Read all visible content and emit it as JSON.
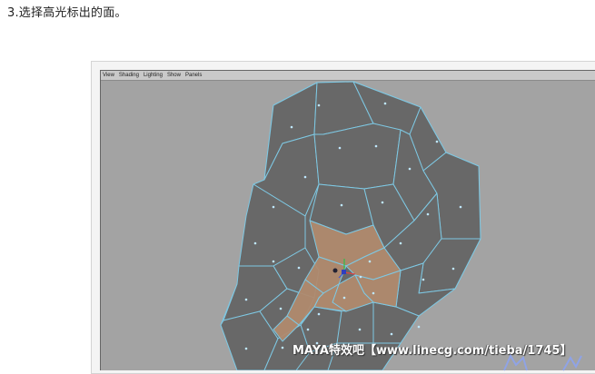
{
  "instruction": {
    "text": "3.选择高光标出的面。"
  },
  "viewport": {
    "menu": [
      "View",
      "Shading",
      "Lighting",
      "Show",
      "Panels"
    ],
    "background_color": "#a3a3a3",
    "face_color": "#686868",
    "selected_face_color": "#b08a6e",
    "edge_color": "#7ec8e3",
    "face_dot_color": "#bfe8ff"
  },
  "watermark": {
    "text": "MAYA特效吧【www.linecg.com/tieba/1745】"
  },
  "icons": [
    "manipulator-gizmo-icon",
    "star-decoration-icon"
  ]
}
